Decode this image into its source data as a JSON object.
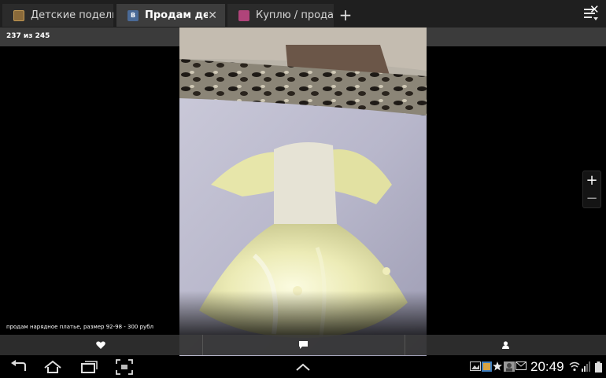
{
  "tabs": [
    {
      "label": "Детские поделки...",
      "icon": "photo-album-favicon-icon",
      "active": false
    },
    {
      "label": "Продам де...",
      "icon": "vk-favicon-icon",
      "active": true,
      "close": "✕"
    },
    {
      "label": "Куплю / продам ...",
      "icon": "pink-favicon-icon",
      "active": false
    }
  ],
  "new_tab": "+",
  "viewer": {
    "counter": "237 из 245",
    "close": "✕",
    "zoom_in": "+",
    "zoom_out": "−",
    "caption": "продам нарядное платье, размер 92-98 - 300 рубл"
  },
  "actions": {
    "like": "heart-icon",
    "comment": "comment-icon",
    "profile": "user-icon"
  },
  "status_bar": {
    "time": "20:49"
  },
  "colors": {
    "tab_active": "#3d3d3d",
    "tab_inactive": "#2b2b2b",
    "header": "#3b3b3b",
    "vk_blue": "#4a6a97"
  }
}
